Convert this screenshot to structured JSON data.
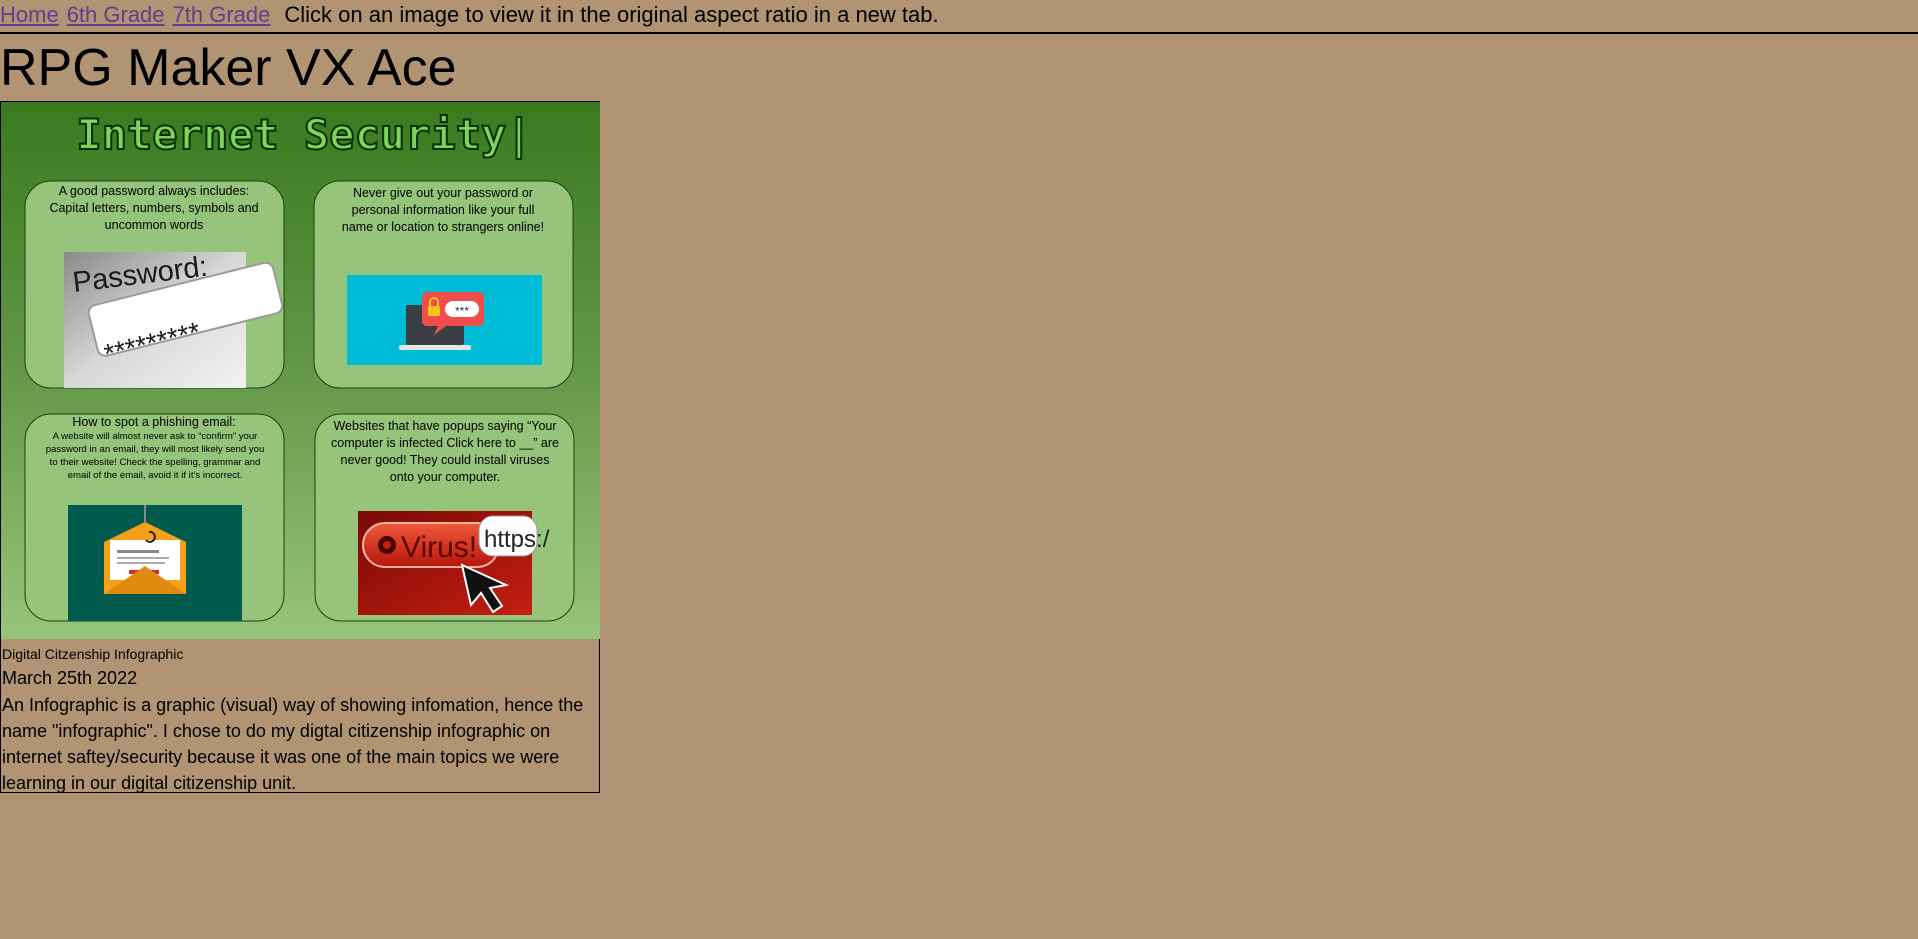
{
  "nav": {
    "links": [
      "Home",
      "6th Grade",
      "7th Grade"
    ],
    "hint": "Click on an image to view it in the original aspect ratio in a new tab."
  },
  "page": {
    "title": "RPG Maker VX Ace"
  },
  "post": {
    "image": {
      "heading": "Internet Security|",
      "panels": [
        "A good password always includes: Capital letters, numbers, symbols and uncommon words",
        "Never give out your password or personal information like your full name or location to strangers online!",
        "How to spot a phishing email:",
        "Websites that have popups saying “Your computer is infected Click here to __” are never good! They could install viruses onto your computer."
      ],
      "phishing_detail": "A website will almost never ask to “confirm” your password in an email, they will most likely send you to their website! Check the spelling, grammar and email of the email, avoid it if it’s incorrect.",
      "password_label": "Password:",
      "password_mask": "*********",
      "bubble_mask": "***",
      "virus_label": "Virus!",
      "https_label": "https:/",
      "icons": [
        "password-field-image",
        "laptop-lock-icon",
        "envelope-hook-icon",
        "virus-button-image"
      ],
      "colors": {
        "bg_top": "#3a7a1e",
        "bg_bottom": "#97c47b",
        "panel": "#95c47a",
        "cyan": "#00bcd4",
        "teal": "#005a4e"
      }
    },
    "image_caption": "Digital Citzenship Infographic",
    "date": "March 25th 2022",
    "description": "An Infographic is a graphic (visual) way of showing infomation, hence the name \"infographic\". I chose to do my digtal citizenship infographic on internet saftey/security because it was one of the main topics we were learning in our digital citizenship unit."
  }
}
